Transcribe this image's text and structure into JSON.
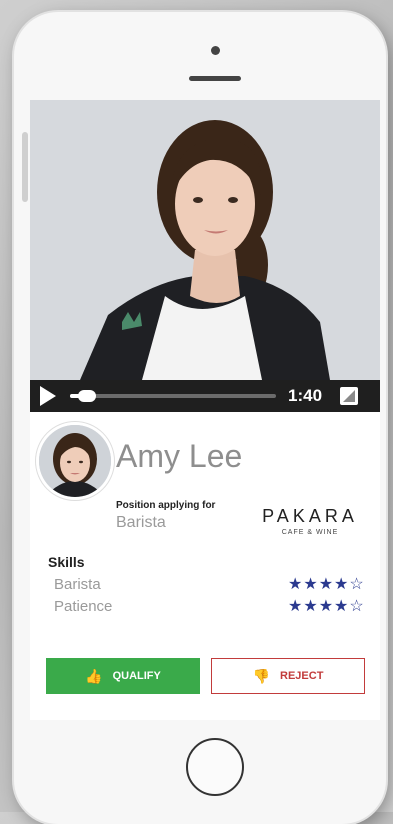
{
  "video": {
    "time": "1:40",
    "progress": 0.06
  },
  "profile": {
    "name": "Amy Lee",
    "position_label": "Position applying for",
    "position_value": "Barista"
  },
  "brand": {
    "name": "PAKARA",
    "tagline": "CAFE & WINE"
  },
  "skills": {
    "title": "Skills",
    "items": [
      {
        "label": "Barista",
        "rating": 4,
        "max": 5,
        "stars": "★★★★☆"
      },
      {
        "label": "Patience",
        "rating": 4,
        "max": 5,
        "stars": "★★★★☆"
      }
    ]
  },
  "actions": {
    "qualify_label": "QUALIFY",
    "reject_label": "REJECT"
  },
  "colors": {
    "qualify": "#3aaa4a",
    "reject": "#c23b3b",
    "stars": "#2b3a8f"
  }
}
